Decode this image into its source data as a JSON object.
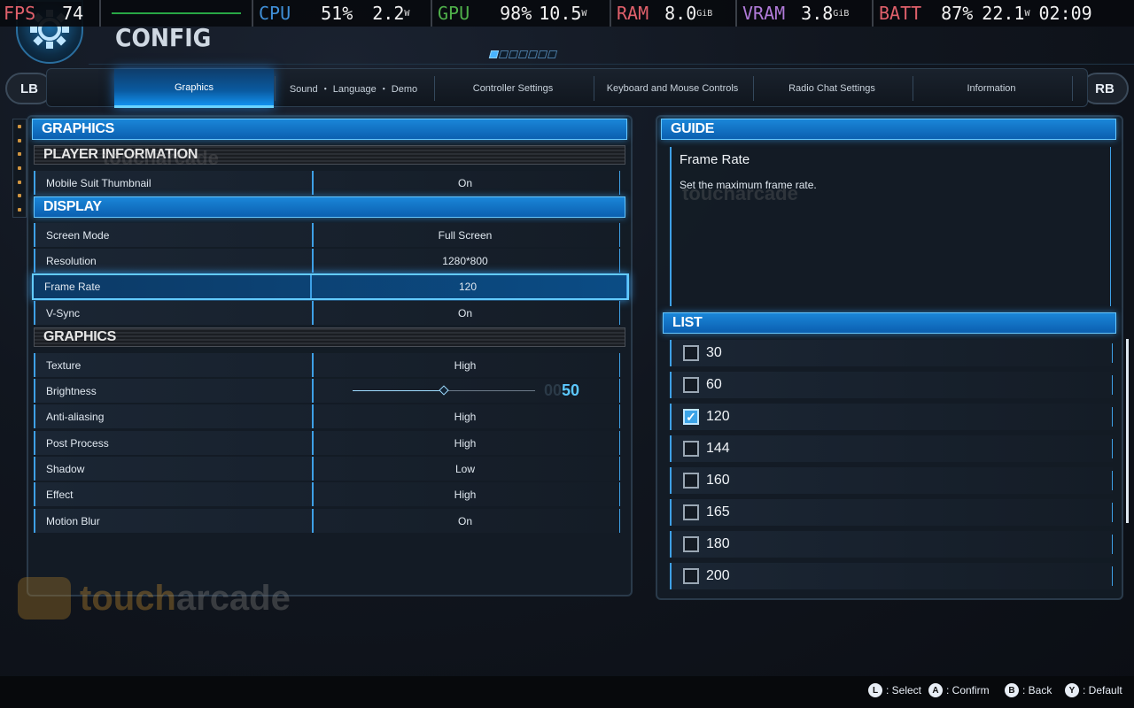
{
  "perf": {
    "fps_label": "FPS",
    "fps_value": "74",
    "cpu_label": "CPU",
    "cpu_pct": "51%",
    "cpu_watts": "2.2",
    "cpu_unit": "W",
    "gpu_label": "GPU",
    "gpu_pct": "98%",
    "gpu_watts": "10.5",
    "gpu_unit": "W",
    "ram_label": "RAM",
    "ram_value": "8.0",
    "ram_unit": "GiB",
    "vram_label": "VRAM",
    "vram_value": "3.8",
    "vram_unit": "GiB",
    "batt_label": "BATT",
    "batt_pct": "87%",
    "batt_watts": "22.1",
    "batt_unit": "W",
    "clock": "02:09"
  },
  "header": {
    "title": "CONFIG"
  },
  "tabs": {
    "lb": "LB",
    "rb": "RB",
    "items": [
      "Graphics",
      "Sound ・ Language ・ Demo",
      "Controller Settings",
      "Keyboard and Mouse Controls",
      "Radio Chat Settings",
      "Information"
    ],
    "active": 0
  },
  "left": {
    "header": "GRAPHICS",
    "player_info": {
      "title": "PLAYER INFORMATION",
      "rows": [
        {
          "label": "Mobile Suit Thumbnail",
          "value": "On"
        }
      ]
    },
    "display": {
      "title": "DISPLAY",
      "rows": [
        {
          "label": "Screen Mode",
          "value": "Full Screen"
        },
        {
          "label": "Resolution",
          "value": "1280*800"
        },
        {
          "label": "Frame Rate",
          "value": "120"
        },
        {
          "label": "V-Sync",
          "value": "On"
        }
      ]
    },
    "graphics": {
      "title": "GRAPHICS",
      "rows": [
        {
          "label": "Texture",
          "value": "High"
        },
        {
          "label": "Brightness",
          "value": ""
        },
        {
          "label": "Anti-aliasing",
          "value": "High"
        },
        {
          "label": "Post Process",
          "value": "High"
        },
        {
          "label": "Shadow",
          "value": "Low"
        },
        {
          "label": "Effect",
          "value": "High"
        },
        {
          "label": "Motion Blur",
          "value": "On"
        }
      ]
    },
    "brightness": {
      "value": 50,
      "max": 100,
      "display_prefix": "00",
      "display": "50"
    }
  },
  "guide": {
    "header": "GUIDE",
    "title": "Frame Rate",
    "text": "Set the maximum frame rate."
  },
  "list": {
    "header": "LIST",
    "items": [
      {
        "label": "30",
        "checked": false
      },
      {
        "label": "60",
        "checked": false
      },
      {
        "label": "120",
        "checked": true
      },
      {
        "label": "144",
        "checked": false
      },
      {
        "label": "160",
        "checked": false
      },
      {
        "label": "165",
        "checked": false
      },
      {
        "label": "180",
        "checked": false
      },
      {
        "label": "200",
        "checked": false
      }
    ]
  },
  "watermark": {
    "part1": "touch",
    "part2": "arcade"
  },
  "footer": {
    "hints": [
      {
        "key": "L",
        "label": ": Select"
      },
      {
        "key": "A",
        "label": ": Confirm"
      },
      {
        "key": "B",
        "label": ": Back"
      },
      {
        "key": "Y",
        "label": ": Default"
      }
    ]
  },
  "colors": {
    "accent": "#3ea0e6",
    "highlight": "#63cbff",
    "header_blue": "#1a86d8"
  }
}
